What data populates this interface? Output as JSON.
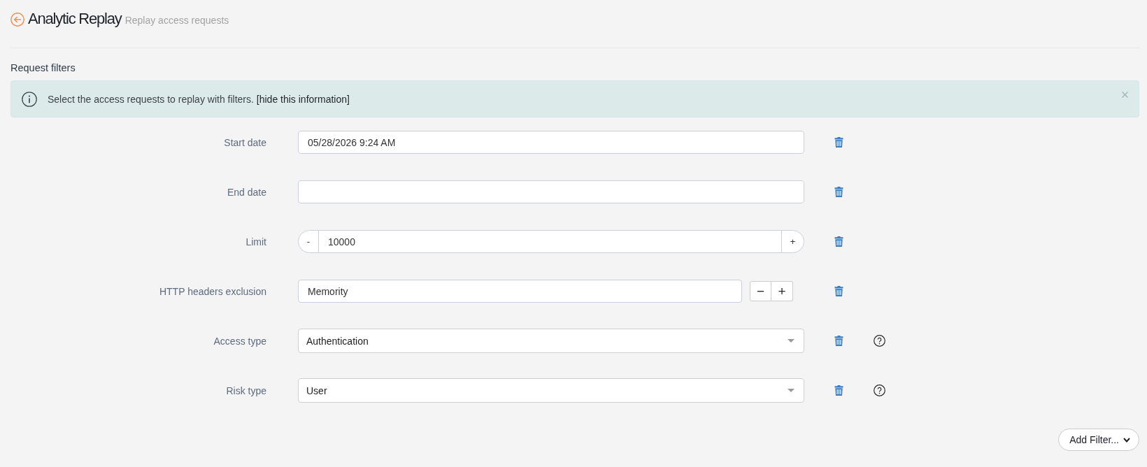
{
  "header": {
    "title": "Analytic Replay",
    "subtitle": "Replay access requests"
  },
  "section_title": "Request filters",
  "info_banner": {
    "message": "Select the access requests to replay with filters.",
    "link": "[hide this information]"
  },
  "filters": [
    {
      "kind": "text",
      "label": "Start date",
      "value": "05/28/2026 9:24 AM",
      "help": false
    },
    {
      "kind": "text",
      "label": "End date",
      "help": false
    },
    {
      "kind": "stepper",
      "label": "Limit",
      "value": "10000",
      "decrement": "-",
      "increment": "+",
      "help": false
    },
    {
      "kind": "list",
      "label": "HTTP headers exclusion",
      "value": "Memority",
      "decrement": "−",
      "increment": "+",
      "help": false
    },
    {
      "kind": "select",
      "label": "Access type",
      "value": "Authentication",
      "help": true
    },
    {
      "kind": "select",
      "label": "Risk type",
      "value": "User",
      "help": true
    }
  ],
  "add_filter_button": "Add Filter..."
}
